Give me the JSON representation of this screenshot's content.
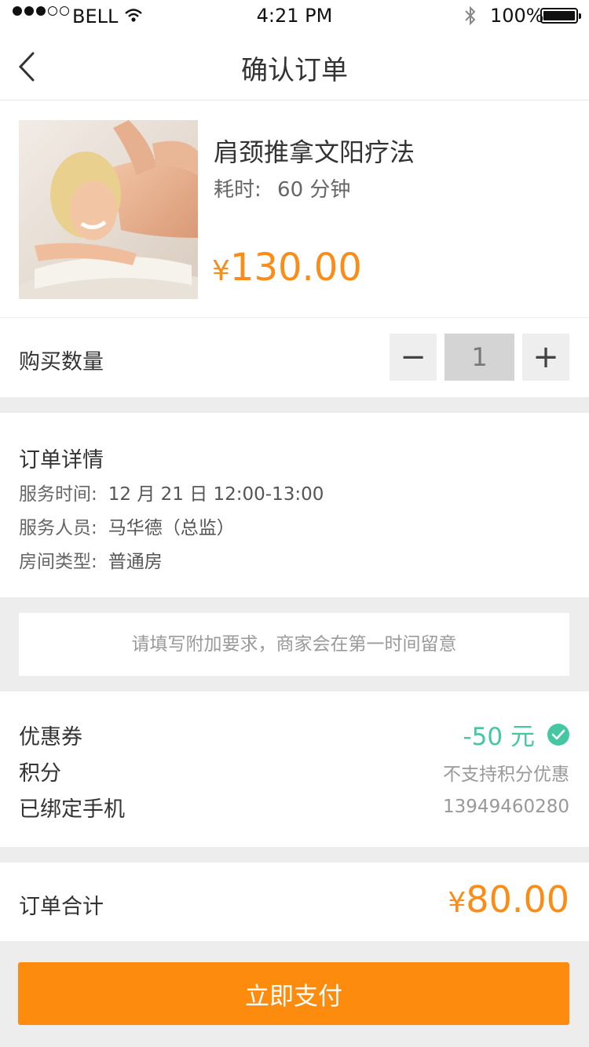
{
  "status_bar": {
    "carrier": "BELL",
    "time": "4:21 PM",
    "battery": "100%",
    "signal_filled": 3,
    "signal_total": 5
  },
  "nav": {
    "title": "确认订单",
    "back_icon": "chevron-left-icon"
  },
  "product": {
    "name": "肩颈推拿文阳疗法",
    "duration_label": "耗时:",
    "duration_value": "60 分钟",
    "currency": "¥",
    "price": "130.00"
  },
  "quantity": {
    "label": "购买数量",
    "minus": "−",
    "value": "1",
    "plus": "+"
  },
  "order_details": {
    "heading": "订单详情",
    "rows": [
      {
        "label": "服务时间:",
        "value": "12 月 21 日  12:00-13:00"
      },
      {
        "label": "服务人员:",
        "value": "马华德（总监）"
      },
      {
        "label": "房间类型:",
        "value": "普通房"
      }
    ]
  },
  "note": {
    "placeholder": "请填写附加要求，商家会在第一时间留意",
    "value": ""
  },
  "discounts": {
    "coupon_label": "优惠券",
    "coupon_value": "-50 元",
    "points_label": "积分",
    "points_value": "不支持积分优惠",
    "phone_label": "已绑定手机",
    "phone_value": "13949460280"
  },
  "total": {
    "label": "订单合计",
    "currency": "¥",
    "amount": "80.00"
  },
  "pay_button": "立即支付",
  "colors": {
    "accent": "#fb8c17",
    "pay_button": "#fd8b0d",
    "coupon": "#46c7a4",
    "section_gap": "#ededed"
  }
}
